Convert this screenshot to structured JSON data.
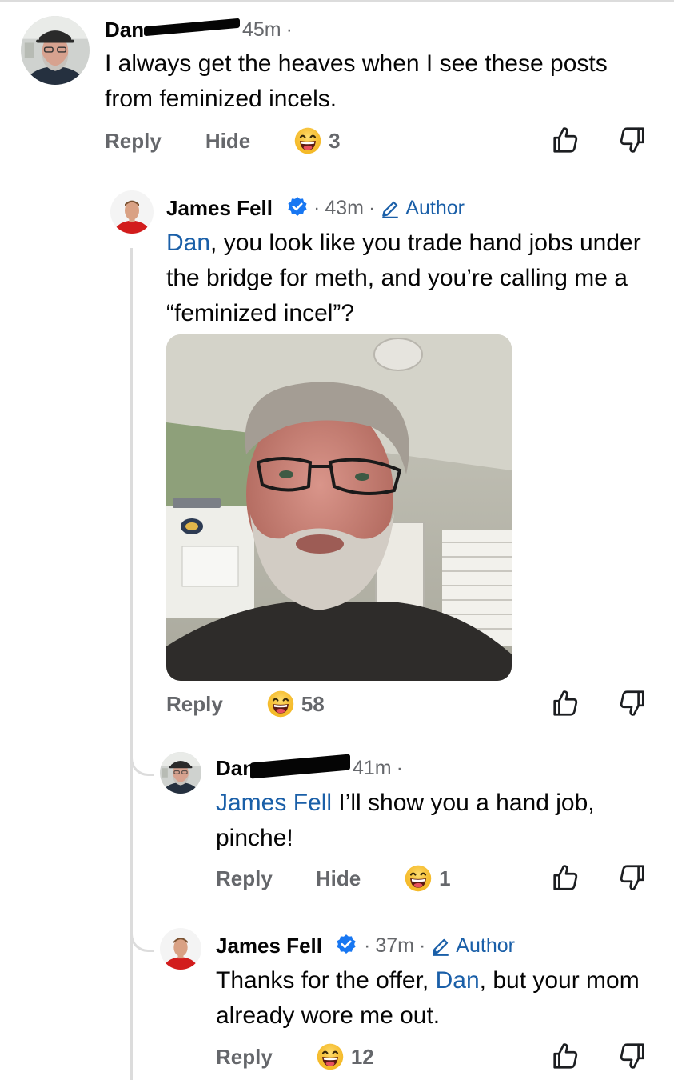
{
  "comments": [
    {
      "author": "Dan",
      "time": "45m",
      "dot": "·",
      "text": "I always get the heaves when I see these posts from feminized incels.",
      "reply": "Reply",
      "hide": "Hide",
      "reaction_count": "3"
    },
    {
      "author": "James Fell",
      "time": "43m",
      "dot": "·",
      "badge": "Author",
      "mention": "Dan",
      "text": ", you look like you trade hand jobs under the bridge for meth, and you’re calling me a “feminized incel”?",
      "reply": "Reply",
      "reaction_count": "58"
    },
    {
      "author": "Dan",
      "time": "41m",
      "dot": "·",
      "mention": "James Fell",
      "text": " I’ll show you a hand job, pinche!",
      "reply": "Reply",
      "hide": "Hide",
      "reaction_count": "1"
    },
    {
      "author": "James Fell",
      "time": "37m",
      "dot": "·",
      "badge": "Author",
      "text_before": "Thanks for the offer, ",
      "mention": "Dan",
      "text_after": ", but your mom already wore me out.",
      "reply": "Reply",
      "reaction_count": "12"
    }
  ],
  "icons": {
    "reaction": "laughing-emoji-icon",
    "upvote": "thumbs-up-outline-icon",
    "downvote": "thumbs-down-outline-icon",
    "verified": "verified-badge-icon",
    "author": "pencil-icon"
  },
  "colors": {
    "link": "#1a5fa8",
    "muted": "#65676b",
    "verified": "#1877f2",
    "thread_line": "#dcdcdc"
  }
}
